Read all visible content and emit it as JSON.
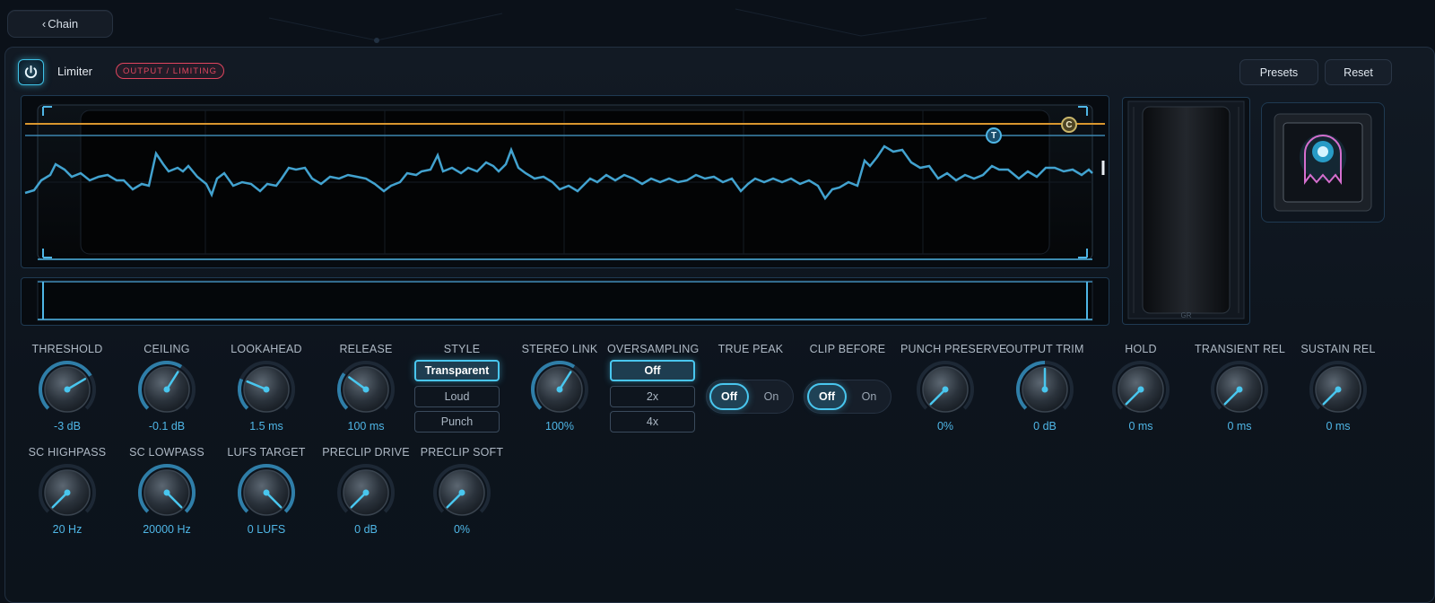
{
  "nav": {
    "back_label": "Chain",
    "back_chevron": "‹"
  },
  "header": {
    "title": "Limiter",
    "badge": "OUTPUT / LIMITING",
    "presets_label": "Presets",
    "reset_label": "Reset"
  },
  "scope": {
    "threshold_marker": "T",
    "ceiling_marker": "C",
    "gr_label": "GR"
  },
  "colors": {
    "accent": "#49c6ee",
    "value": "#4fb6e6",
    "ceiling_line": "#d9962e",
    "badge": "#e0455e"
  },
  "row1": [
    {
      "label": "THRESHOLD",
      "value": "-3 dB",
      "level": 0.72
    },
    {
      "label": "CEILING",
      "value": "-0.1 dB",
      "level": 0.62
    },
    {
      "label": "LOOKAHEAD",
      "value": "1.5 ms",
      "level": 0.25
    },
    {
      "label": "RELEASE",
      "value": "100 ms",
      "level": 0.3
    }
  ],
  "style": {
    "label": "STYLE",
    "options": [
      "Transparent",
      "Loud",
      "Punch"
    ],
    "selected": "Transparent"
  },
  "stereo_link": {
    "label": "STEREO LINK",
    "value": "100%",
    "level": 0.62
  },
  "oversampling": {
    "label": "OVERSAMPLING",
    "options": [
      "Off",
      "2x",
      "4x"
    ],
    "selected": "Off"
  },
  "true_peak": {
    "label": "TRUE PEAK",
    "off": "Off",
    "on": "On",
    "selected": "Off"
  },
  "clip_before": {
    "label": "CLIP BEFORE",
    "off": "Off",
    "on": "On",
    "selected": "Off"
  },
  "right_knobs": [
    {
      "label": "PUNCH PRESERVE",
      "value": "0%",
      "level": 0.0
    },
    {
      "label": "OUTPUT TRIM",
      "value": "0 dB",
      "level": 0.5
    },
    {
      "label": "HOLD",
      "value": "0 ms",
      "level": 0.0
    },
    {
      "label": "TRANSIENT REL",
      "value": "0 ms",
      "level": 0.0
    },
    {
      "label": "SUSTAIN REL",
      "value": "0 ms",
      "level": 0.0
    }
  ],
  "row2": [
    {
      "label": "SC HIGHPASS",
      "value": "20 Hz",
      "level": 0.0
    },
    {
      "label": "SC LOWPASS",
      "value": "20000 Hz",
      "level": 1.0
    },
    {
      "label": "LUFS TARGET",
      "value": "0 LUFS",
      "level": 1.0
    },
    {
      "label": "PRECLIP DRIVE",
      "value": "0 dB",
      "level": 0.0
    },
    {
      "label": "PRECLIP SOFT",
      "value": "0%",
      "level": 0.0
    }
  ]
}
